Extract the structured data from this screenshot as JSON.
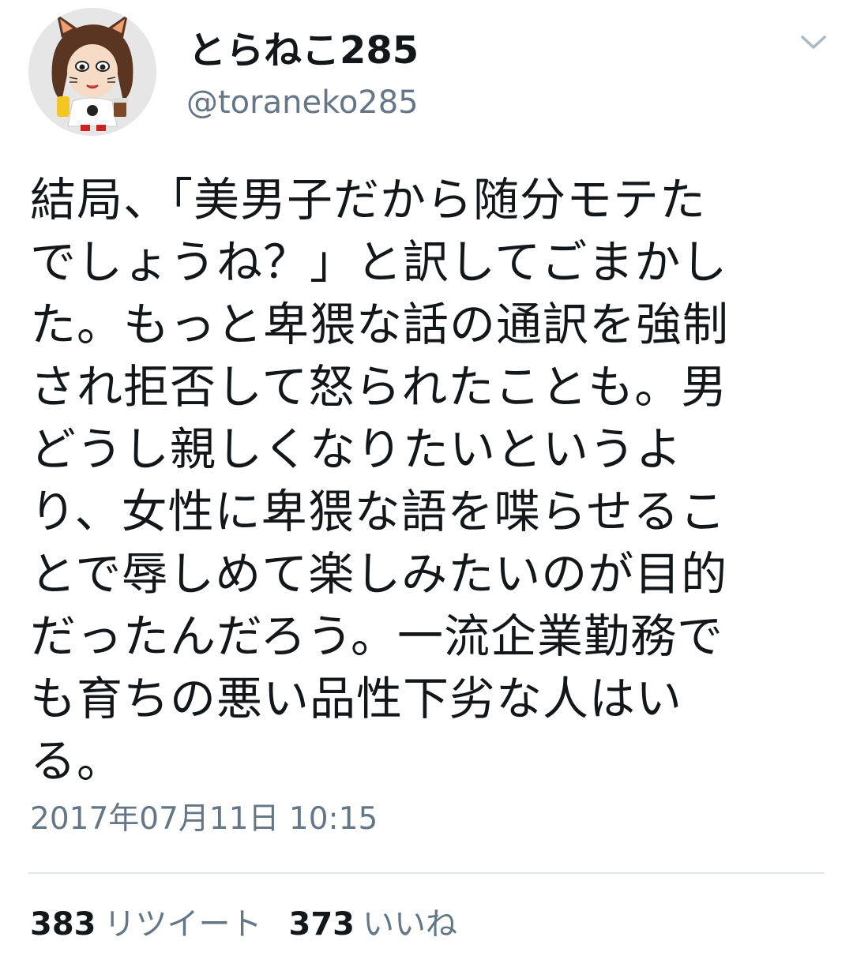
{
  "user": {
    "display_name": "とらねこ285",
    "screen_name": "@toraneko285"
  },
  "tweet": {
    "text": "結局、「美男子だから随分モテた\nでしょうね？」と訳してごまかし\nた。もっと卑猥な話の通訳を強制\nされ拒否して怒られたことも。男\nどうし親しくなりたいというよ\nり、女性に卑猥な語を喋らせるこ\nとで辱しめて楽しみたいのが目的\nだったんだろう。一流企業勤務で\nも育ちの悪い品性下劣な人はい\nる。",
    "timestamp": "2017年07月11日 10:15"
  },
  "stats": {
    "retweets_count": "383",
    "retweets_label": "リツイート",
    "likes_count": "373",
    "likes_label": "いいね"
  },
  "colors": {
    "text": "#14171a",
    "secondary": "#657786",
    "divider": "#e1e8ed",
    "chevron": "#aab8c2"
  },
  "icons": {
    "menu": "chevron-down-icon"
  }
}
